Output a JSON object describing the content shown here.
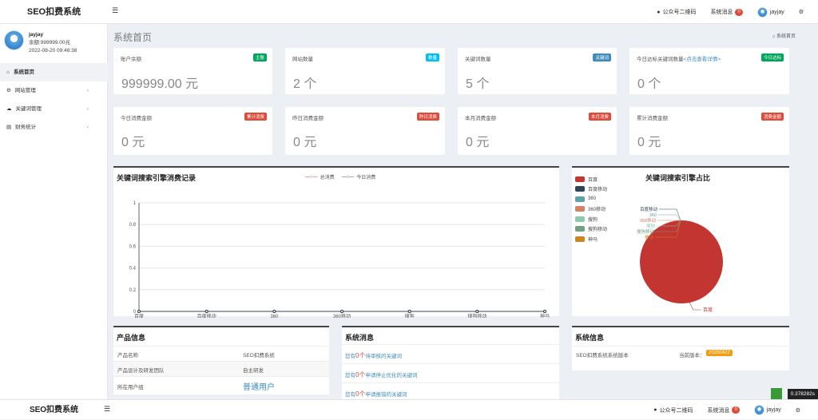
{
  "app": {
    "logo": "SEO扣费系统"
  },
  "top": {
    "qr_label": "公众号二维码",
    "msg_label": "系统消息",
    "msg_count": "0",
    "user": "jayjay"
  },
  "user": {
    "name": "jayjay",
    "balance": "余额:999999.00元",
    "datetime": "2022-08-20 09:48:38"
  },
  "nav": [
    {
      "label": "系统首页"
    },
    {
      "label": "网站管理"
    },
    {
      "label": "关键词管理"
    },
    {
      "label": "财务统计"
    }
  ],
  "page": {
    "title": "系统首页",
    "crumb": "系统首页"
  },
  "cards_row1": [
    {
      "label": "账户余额",
      "tag": "主账",
      "tag_color": "#00a65a",
      "value": "999999.00 元"
    },
    {
      "label": "网站数量",
      "tag": "数量",
      "tag_color": "#00c0ef",
      "value": "2 个"
    },
    {
      "label": "关键词数量",
      "tag": "关键词",
      "tag_color": "#3c8dbc",
      "value": "5 个"
    },
    {
      "label": "今日达标关键词数量",
      "link": "<点击查看详情>",
      "tag": "今日达标",
      "tag_color": "#00a65a",
      "value": "0 个"
    }
  ],
  "cards_row2": [
    {
      "label": "今日消费金额",
      "tag": "累计消费",
      "tag_color": "#dd4b39",
      "value": "0 元"
    },
    {
      "label": "昨日消费金额",
      "tag": "昨日消费",
      "tag_color": "#dd4b39",
      "value": "0 元"
    },
    {
      "label": "本月消费金额",
      "tag": "本月消费",
      "tag_color": "#dd4b39",
      "value": "0 元"
    },
    {
      "label": "累计消费金额",
      "tag": "消费金额",
      "tag_color": "#dd4b39",
      "value": "0 元"
    }
  ],
  "line_panel": {
    "title": "关键词搜索引擎消费记录",
    "legend": [
      "总消费",
      "今日消费"
    ]
  },
  "pie_panel": {
    "title": "关键词搜索引擎占比"
  },
  "chart_data": [
    {
      "type": "line",
      "title": "关键词搜索引擎消费记录",
      "categories": [
        "百度",
        "百度移动",
        "360",
        "360移动",
        "搜狗",
        "搜狗移动",
        "神马"
      ],
      "ylim": [
        0,
        1
      ],
      "yticks": [
        "0",
        "0.2",
        "0.4",
        "0.6",
        "0.8",
        "1"
      ],
      "series": [
        {
          "name": "总消费",
          "values": [
            0,
            0,
            0,
            0,
            0,
            0,
            0
          ],
          "color": "#c23531"
        },
        {
          "name": "今日消费",
          "values": [
            0,
            0,
            0,
            0,
            0,
            0,
            0
          ],
          "color": "#2f4554"
        }
      ],
      "legend": "top"
    },
    {
      "type": "pie",
      "title": "关键词搜索引擎占比",
      "labels": [
        "百度",
        "百度移动",
        "360",
        "360移动",
        "搜狗",
        "搜狗移动",
        "神马"
      ],
      "values": [
        100,
        0,
        0,
        0,
        0,
        0,
        0
      ],
      "colors": [
        "#c23531",
        "#2f4554",
        "#61a0a8",
        "#d48265",
        "#91c7ae",
        "#749f83",
        "#ca8622"
      ],
      "legend": "left"
    }
  ],
  "product": {
    "title": "产品信息",
    "rows": [
      {
        "k": "产品名称",
        "v": "SEO扣费系统"
      },
      {
        "k": "产品设计及研发团队",
        "v": "自主研发"
      },
      {
        "k": "所在用户组",
        "v": "普通用户"
      }
    ]
  },
  "messages": {
    "title": "系统消息",
    "items": [
      {
        "pre": "您有",
        "count": "0个",
        "post": "待审核的关键词"
      },
      {
        "pre": "您有",
        "count": "0个",
        "post": "申请停止优化的关键词"
      },
      {
        "pre": "您有",
        "count": "0个",
        "post": "申请报错的关键词"
      }
    ]
  },
  "sysinfo": {
    "title": "系统信息",
    "label": "SEO扣费系统系统版本",
    "ver_label": "当前版本：",
    "version": "20200422"
  },
  "bottom": {
    "logo": "SEO扣费系统",
    "qr_label": "公众号二维码",
    "msg_label": "系统消息",
    "msg_count": "0",
    "user": "jayjay"
  },
  "timer": "0.378282s"
}
